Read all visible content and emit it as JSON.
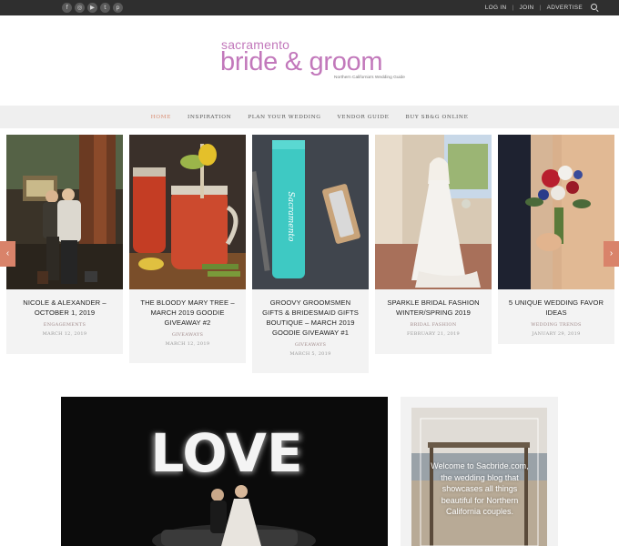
{
  "topbar": {
    "social": [
      "f",
      "◎",
      "▶",
      "t",
      "p"
    ],
    "links": [
      "LOG IN",
      "JOIN",
      "ADVERTISE"
    ],
    "separator": "|"
  },
  "logo": {
    "line1": "sacramento",
    "line2": "bride & groom",
    "tagline": "Northern California's Wedding Guide"
  },
  "nav": {
    "items": [
      "HOME",
      "INSPIRATION",
      "PLAN YOUR WEDDING",
      "VENDOR GUIDE",
      "BUY SB&G ONLINE"
    ]
  },
  "carousel": {
    "cards": [
      {
        "title": "NICOLE & ALEXANDER – OCTOBER 1, 2019",
        "category": "ENGAGEMENTS",
        "date": "MARCH 12, 2019"
      },
      {
        "title": "THE BLOODY MARY TREE – MARCH 2019 GOODIE GIVEAWAY #2",
        "category": "GIVEAWAYS",
        "date": "MARCH 12, 2019"
      },
      {
        "title": "GROOVY GROOMSMEN GIFTS & BRIDESMAID GIFTS BOUTIQUE – MARCH 2019 GOODIE GIVEAWAY #1",
        "category": "GIVEAWAYS",
        "date": "MARCH 5, 2019"
      },
      {
        "title": "SPARKLE BRIDAL FASHION WINTER/SPRING 2019",
        "category": "BRIDAL FASHION",
        "date": "FEBRUARY 21, 2019"
      },
      {
        "title": "5 UNIQUE WEDDING FAVOR IDEAS",
        "category": "WEDDING TRENDS",
        "date": "JANUARY 29, 2019"
      }
    ],
    "prev": "‹",
    "next": "›"
  },
  "feature": {
    "sign": "LOVE"
  },
  "sidebar": {
    "welcome": "Welcome to Sacbride.com, the wedding blog that showcases all things beautiful for Northern California couples."
  },
  "colors": {
    "logo": "#c278bb",
    "accent": "#d9836a",
    "topbar": "#2f2f2f"
  }
}
